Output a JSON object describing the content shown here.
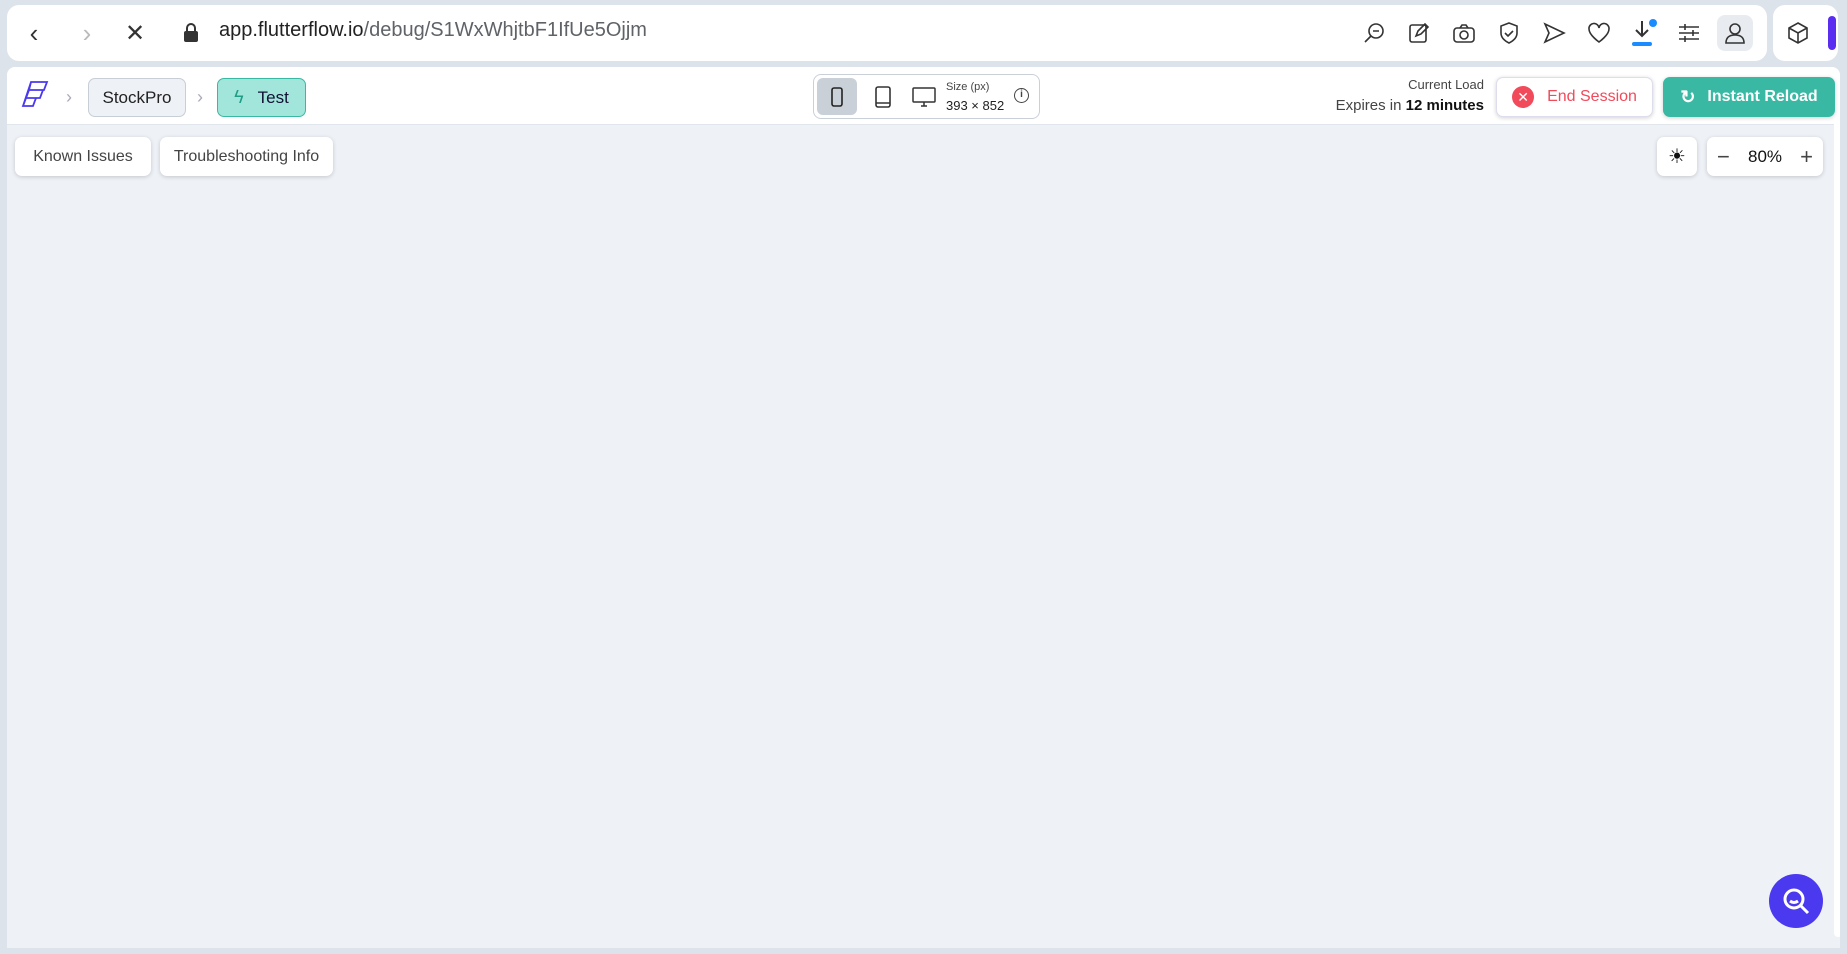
{
  "browser": {
    "url_host": "app.flutterflow.io",
    "url_path": "/debug/S1WxWhjtbF1IfUe5Ojjm"
  },
  "breadcrumb": {
    "project": "StockPro",
    "mode": "Test"
  },
  "device": {
    "size_label": "Size (px)",
    "size_value": "393 × 852"
  },
  "session": {
    "current_load": "Current Load",
    "expires_prefix": "Expires in",
    "expires_value": "12 minutes",
    "end_label": "End Session",
    "reload_label": "Instant Reload"
  },
  "toolbar": {
    "known_issues": "Known Issues",
    "troubleshooting": "Troubleshooting Info",
    "zoom": "80%"
  },
  "colors": {
    "accent": "#39b9a4",
    "danger": "#f04a5b",
    "brand": "#4b39ef"
  }
}
